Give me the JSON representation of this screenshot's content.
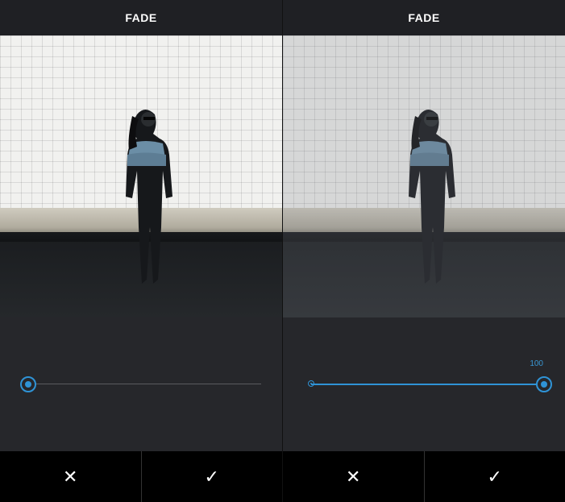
{
  "panels": [
    {
      "title": "FADE",
      "slider": {
        "value_label": "",
        "fraction": 0.0
      },
      "cancel_icon": "✕",
      "confirm_icon": "✓"
    },
    {
      "title": "FADE",
      "slider": {
        "value_label": "100",
        "fraction": 1.0
      },
      "cancel_icon": "✕",
      "confirm_icon": "✓"
    }
  ],
  "colors": {
    "accent": "#2f93d6",
    "background": "#26272b",
    "header_bg": "#1f2024",
    "bottom_bar": "#000000"
  },
  "icons": {
    "cancel": "close-icon",
    "confirm": "checkmark-icon"
  }
}
